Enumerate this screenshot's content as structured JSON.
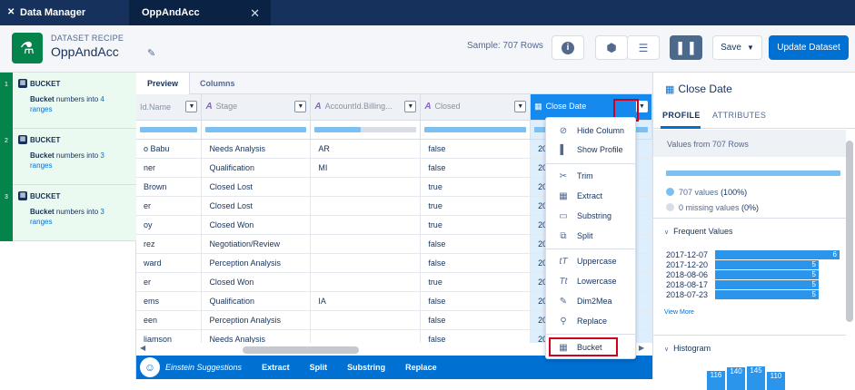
{
  "tabs": [
    {
      "label": "Data Manager",
      "icon": "tools-icon"
    },
    {
      "label": "OppAndAcc",
      "close": "✕"
    }
  ],
  "header": {
    "subtitle": "DATASET RECIPE",
    "title": "OppAndAcc",
    "sample": "Sample: 707 Rows",
    "save_label": "Save",
    "update_label": "Update Dataset"
  },
  "steps": [
    {
      "number": "1",
      "title": "BUCKET",
      "desc_bold": "Bucket",
      "desc_mid": " numbers into ",
      "desc_count": "4",
      "desc_end": "ranges"
    },
    {
      "number": "2",
      "title": "BUCKET",
      "desc_bold": "Bucket",
      "desc_mid": " numbers into ",
      "desc_count": "3",
      "desc_end": "ranges"
    },
    {
      "number": "3",
      "title": "BUCKET",
      "desc_bold": "Bucket",
      "desc_mid": " numbers into ",
      "desc_count": "3",
      "desc_end": "ranges"
    }
  ],
  "grid_tabs": {
    "preview": "Preview",
    "columns": "Columns"
  },
  "columns": [
    "Id.Name",
    "Stage",
    "AccountId.Billing...",
    "Closed",
    "Close Date"
  ],
  "rows": [
    [
      "o Babu",
      "Needs Analysis",
      "AR",
      "false",
      "20"
    ],
    [
      "ner",
      "Qualification",
      "MI",
      "false",
      "20"
    ],
    [
      "Brown",
      "Closed Lost",
      "",
      "true",
      "20"
    ],
    [
      "er",
      "Closed Lost",
      "",
      "true",
      "20"
    ],
    [
      "oy",
      "Closed Won",
      "",
      "true",
      "20"
    ],
    [
      "rez",
      "Negotiation/Review",
      "",
      "false",
      "20"
    ],
    [
      "ward",
      "Perception Analysis",
      "",
      "false",
      "20"
    ],
    [
      "er",
      "Closed Won",
      "",
      "true",
      "20"
    ],
    [
      "ems",
      "Qualification",
      "IA",
      "false",
      "20"
    ],
    [
      "een",
      "Perception Analysis",
      "",
      "false",
      "20"
    ],
    [
      "liamson",
      "Needs Analysis",
      "",
      "false",
      "20"
    ]
  ],
  "einstein": {
    "label": "Einstein Suggestions",
    "items": [
      "Extract",
      "Split",
      "Substring",
      "Replace"
    ]
  },
  "menu": [
    {
      "label": "Hide Column",
      "icon": "hide-icon"
    },
    {
      "label": "Show Profile",
      "icon": "profile-icon"
    },
    {
      "label": "Trim",
      "icon": "scissors-icon"
    },
    {
      "label": "Extract",
      "icon": "calendar-icon"
    },
    {
      "label": "Substring",
      "icon": "substring-icon"
    },
    {
      "label": "Split",
      "icon": "split-icon"
    },
    {
      "label": "Uppercase",
      "icon": "uppercase-icon"
    },
    {
      "label": "Lowercase",
      "icon": "lowercase-icon"
    },
    {
      "label": "Dim2Mea",
      "icon": "pencil-icon"
    },
    {
      "label": "Replace",
      "icon": "search-icon"
    },
    {
      "label": "Bucket",
      "icon": "bucket-icon"
    }
  ],
  "profile": {
    "title": "Close Date",
    "tab_profile": "PROFILE",
    "tab_attributes": "ATTRIBUTES",
    "values_from": "Values from 707 Rows",
    "values_line": "707 values",
    "values_pct": "(100%)",
    "missing_line": "0 missing values",
    "missing_pct": "(0%)",
    "frequent_header": "Frequent Values",
    "frequent": [
      {
        "label": "2017-12-07",
        "count": 6
      },
      {
        "label": "2017-12-20",
        "count": 5
      },
      {
        "label": "2018-08-06",
        "count": 5
      },
      {
        "label": "2018-08-17",
        "count": 5
      },
      {
        "label": "2018-07-23",
        "count": 5
      }
    ],
    "view_more": "View More",
    "histogram_header": "Histogram",
    "histogram_values": [
      "116",
      "140",
      "145",
      "110"
    ]
  },
  "colors": {
    "navy": "#16325c",
    "brand_blue": "#0070d2",
    "green": "#04844b",
    "highlight_red": "#d0021b"
  }
}
